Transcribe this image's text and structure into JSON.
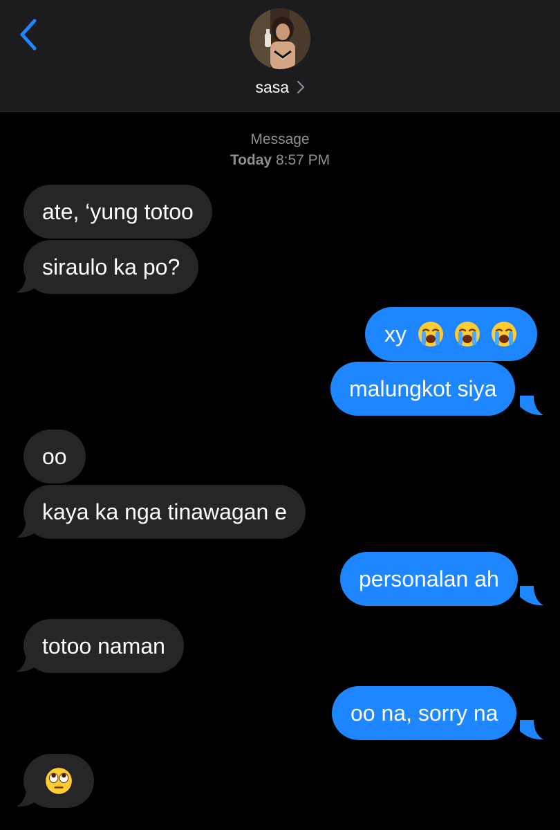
{
  "header": {
    "contact_name": "sasa"
  },
  "conversation": {
    "service_label": "Message",
    "timestamp_day": "Today",
    "timestamp_time": "8:57 PM"
  },
  "messages": [
    {
      "direction": "incoming",
      "text": "ate, ‘yung totoo"
    },
    {
      "direction": "incoming",
      "text": "siraulo ka po?"
    },
    {
      "direction": "outgoing",
      "text": "xy",
      "emojis": [
        "loudly-crying-face",
        "loudly-crying-face",
        "loudly-crying-face"
      ]
    },
    {
      "direction": "outgoing",
      "text": "malungkot siya"
    },
    {
      "direction": "incoming",
      "text": "oo"
    },
    {
      "direction": "incoming",
      "text": "kaya ka nga tinawagan e"
    },
    {
      "direction": "outgoing",
      "text": "personalan ah"
    },
    {
      "direction": "incoming",
      "text": "totoo naman"
    },
    {
      "direction": "outgoing",
      "text": "oo na, sorry na"
    },
    {
      "direction": "incoming",
      "emojis": [
        "face-with-rolling-eyes"
      ]
    }
  ],
  "colors": {
    "incoming_bubble": "#262629",
    "outgoing_bubble": "#1e86ff",
    "accent": "#1e86ff",
    "header_bg": "#1c1c1e",
    "meta_text": "#8e8e93"
  }
}
